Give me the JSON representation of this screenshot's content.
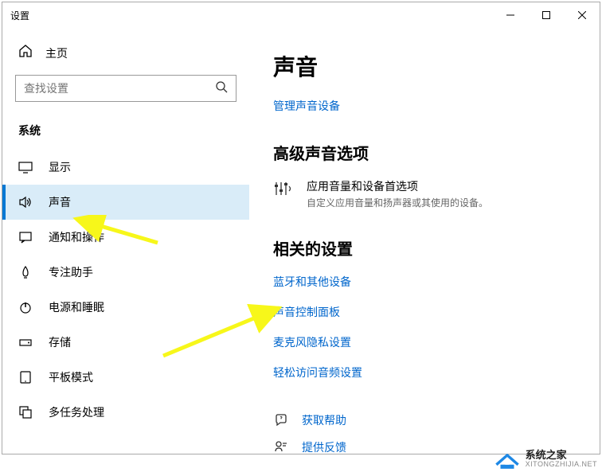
{
  "window": {
    "title": "设置"
  },
  "home": {
    "label": "主页"
  },
  "search": {
    "placeholder": "查找设置"
  },
  "category": {
    "header": "系统"
  },
  "nav": [
    {
      "icon": "display",
      "label": "显示"
    },
    {
      "icon": "sound",
      "label": "声音"
    },
    {
      "icon": "notify",
      "label": "通知和操作"
    },
    {
      "icon": "focus",
      "label": "专注助手"
    },
    {
      "icon": "power",
      "label": "电源和睡眠"
    },
    {
      "icon": "storage",
      "label": "存储"
    },
    {
      "icon": "tablet",
      "label": "平板模式"
    },
    {
      "icon": "multitask",
      "label": "多任务处理"
    }
  ],
  "main": {
    "title": "声音",
    "manageLink": "管理声音设备",
    "advanced": {
      "heading": "高级声音选项",
      "optionTitle": "应用音量和设备首选项",
      "optionDesc": "自定义应用音量和扬声器或其使用的设备。"
    },
    "related": {
      "heading": "相关的设置",
      "links": [
        "蓝牙和其他设备",
        "声音控制面板",
        "麦克风隐私设置",
        "轻松访问音频设置"
      ]
    },
    "footer": {
      "help": "获取帮助",
      "feedback": "提供反馈"
    }
  },
  "watermark": {
    "cn": "系统之家",
    "en": "XITONGZHIJIA.NET"
  }
}
